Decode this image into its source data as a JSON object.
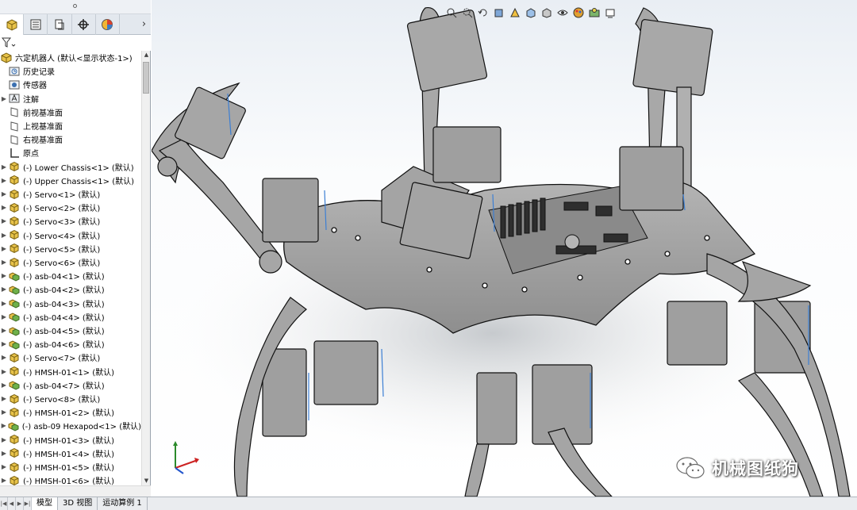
{
  "feature_tree": {
    "root_label": "六定机器人 (默认<显示状态-1>)",
    "items": [
      {
        "label": "历史记录",
        "icon": "history-folder-icon",
        "expandable": false
      },
      {
        "label": "传感器",
        "icon": "sensor-folder-icon",
        "expandable": false
      },
      {
        "label": "注解",
        "icon": "annotation-folder-icon",
        "expandable": true
      },
      {
        "label": "前视基准面",
        "icon": "plane-icon",
        "expandable": false
      },
      {
        "label": "上视基准面",
        "icon": "plane-icon",
        "expandable": false
      },
      {
        "label": "右视基准面",
        "icon": "plane-icon",
        "expandable": false
      },
      {
        "label": "原点",
        "icon": "origin-icon",
        "expandable": false
      },
      {
        "label": "(-) Lower Chassis<1> (默认)",
        "icon": "part-icon",
        "expandable": true
      },
      {
        "label": "(-) Upper Chassis<1> (默认)",
        "icon": "part-icon",
        "expandable": true
      },
      {
        "label": "(-) Servo<1> (默认)",
        "icon": "part-icon",
        "expandable": true
      },
      {
        "label": "(-) Servo<2> (默认)",
        "icon": "part-icon",
        "expandable": true
      },
      {
        "label": "(-) Servo<3> (默认)",
        "icon": "part-icon",
        "expandable": true
      },
      {
        "label": "(-) Servo<4> (默认)",
        "icon": "part-icon",
        "expandable": true
      },
      {
        "label": "(-) Servo<5> (默认)",
        "icon": "part-icon",
        "expandable": true
      },
      {
        "label": "(-) Servo<6> (默认)",
        "icon": "part-icon",
        "expandable": true
      },
      {
        "label": "(-) asb-04<1> (默认)",
        "icon": "subassembly-icon",
        "expandable": true
      },
      {
        "label": "(-) asb-04<2> (默认)",
        "icon": "subassembly-icon",
        "expandable": true
      },
      {
        "label": "(-) asb-04<3> (默认)",
        "icon": "subassembly-icon",
        "expandable": true
      },
      {
        "label": "(-) asb-04<4> (默认)",
        "icon": "subassembly-icon",
        "expandable": true
      },
      {
        "label": "(-) asb-04<5> (默认)",
        "icon": "subassembly-icon",
        "expandable": true
      },
      {
        "label": "(-) asb-04<6> (默认)",
        "icon": "subassembly-icon",
        "expandable": true
      },
      {
        "label": "(-) Servo<7> (默认)",
        "icon": "part-icon",
        "expandable": true
      },
      {
        "label": "(-) HMSH-01<1> (默认)",
        "icon": "part-icon",
        "expandable": true
      },
      {
        "label": "(-) asb-04<7> (默认)",
        "icon": "subassembly-icon",
        "expandable": true
      },
      {
        "label": "(-) Servo<8> (默认)",
        "icon": "part-icon",
        "expandable": true
      },
      {
        "label": "(-) HMSH-01<2> (默认)",
        "icon": "part-icon",
        "expandable": true
      },
      {
        "label": "(-) asb-09 Hexapod<1> (默认)",
        "icon": "subassembly-icon",
        "expandable": true
      },
      {
        "label": "(-) HMSH-01<3> (默认)",
        "icon": "part-icon",
        "expandable": true
      },
      {
        "label": "(-) HMSH-01<4> (默认)",
        "icon": "part-icon",
        "expandable": true
      },
      {
        "label": "(-) HMSH-01<5> (默认)",
        "icon": "part-icon",
        "expandable": true
      },
      {
        "label": "(-) HMSH-01<6> (默认)",
        "icon": "part-icon",
        "expandable": true
      }
    ]
  },
  "bottom_tabs": {
    "model": "模型",
    "view3d": "3D 视图",
    "motion": "运动算例 1"
  },
  "watermark": {
    "text": "机械图纸狗"
  },
  "colors": {
    "panel_bg": "#ffffff",
    "tab_strip": "#e3e8ee",
    "part_gray": "#9c9c9c",
    "edge_black": "#111111",
    "board_dark": "#3b3b3b"
  }
}
